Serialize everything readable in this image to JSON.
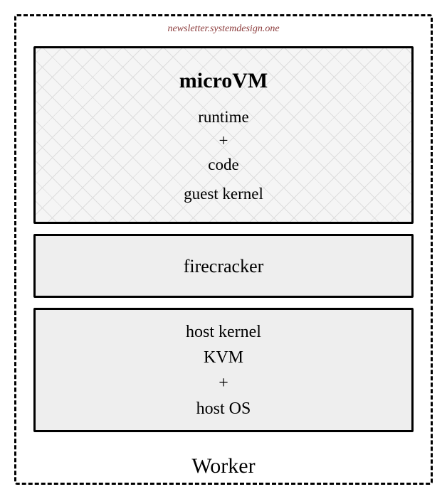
{
  "attribution": "newsletter.systemdesign.one",
  "worker": {
    "label": "Worker",
    "microvm": {
      "title": "microVM",
      "line1": "runtime",
      "line2": "+",
      "line3": "code",
      "line4": "guest kernel"
    },
    "firecracker": {
      "label": "firecracker"
    },
    "host": {
      "line1": "host kernel",
      "line2": "KVM",
      "line3": "+",
      "line4": "host OS"
    }
  }
}
